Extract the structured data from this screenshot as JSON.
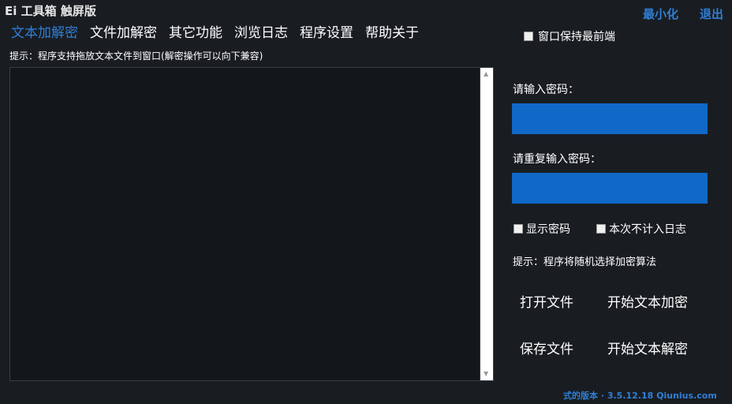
{
  "app": {
    "title": "Ei 工具箱 触屏版",
    "minimize_label": "最小化",
    "exit_label": "退出"
  },
  "tabs": [
    {
      "label": "文本加解密",
      "active": true
    },
    {
      "label": "文件加解密",
      "active": false
    },
    {
      "label": "其它功能",
      "active": false
    },
    {
      "label": "浏览日志",
      "active": false
    },
    {
      "label": "程序设置",
      "active": false
    },
    {
      "label": "帮助关于",
      "active": false
    }
  ],
  "topmost": {
    "label": "窗口保持最前端",
    "checked": false
  },
  "hint_top": "提示：程序支持拖放文本文件到窗口(解密操作可以向下兼容)",
  "editor": {
    "value": ""
  },
  "password": {
    "label": "请输入密码：",
    "value": "",
    "repeat_label": "请重复输入密码：",
    "repeat_value": ""
  },
  "options": {
    "show_password": {
      "label": "显示密码",
      "checked": false
    },
    "no_log": {
      "label": "本次不计入日志",
      "checked": false
    }
  },
  "hint_right": "提示：程序将随机选择加密算法",
  "actions": {
    "open_file": "打开文件",
    "start_encrypt": "开始文本加密",
    "save_file": "保存文件",
    "start_decrypt": "开始文本解密"
  },
  "version": "式的版本 · 3.5.12.18 Qiunius.com",
  "colors": {
    "background": "#191d22",
    "accent": "#2f7fd6",
    "input": "#1068c7"
  }
}
